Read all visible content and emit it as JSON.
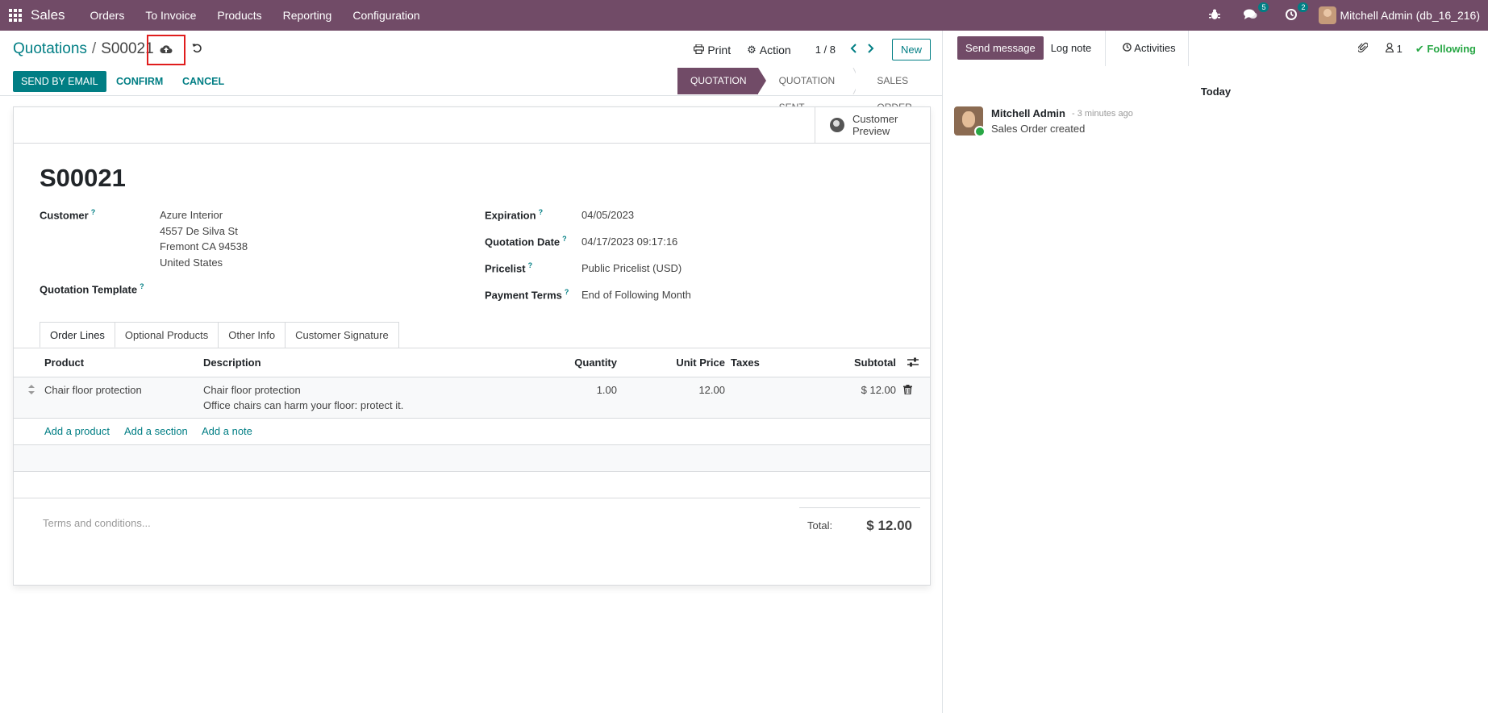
{
  "navbar": {
    "brand": "Sales",
    "menu": [
      "Orders",
      "To Invoice",
      "Products",
      "Reporting",
      "Configuration"
    ],
    "messages_badge": "5",
    "activities_badge": "2",
    "user_name": "Mitchell Admin (db_16_216)",
    "background_color": "#714b67"
  },
  "control_panel": {
    "breadcrumb_parent": "Quotations",
    "breadcrumb_sep": "/",
    "breadcrumb_current": "S00021",
    "print_label": "Print",
    "action_label": "Action",
    "pager": "1 / 8",
    "new_label": "New"
  },
  "actions": {
    "send_by_email": "SEND BY EMAIL",
    "confirm": "CONFIRM",
    "cancel": "CANCEL"
  },
  "stages": [
    "QUOTATION",
    "QUOTATION SENT",
    "SALES ORDER"
  ],
  "active_stage": "QUOTATION",
  "form": {
    "customer_preview": "Customer Preview",
    "title": "S00021",
    "customer_label": "Customer",
    "customer_lines": [
      "Azure Interior",
      "4557 De Silva St",
      "Fremont CA 94538",
      "United States"
    ],
    "quotation_template_label": "Quotation Template",
    "expiration_label": "Expiration",
    "expiration_value": "04/05/2023",
    "quotation_date_label": "Quotation Date",
    "quotation_date_value": "04/17/2023 09:17:16",
    "pricelist_label": "Pricelist",
    "pricelist_value": "Public Pricelist (USD)",
    "payment_terms_label": "Payment Terms",
    "payment_terms_value": "End of Following Month",
    "help_mark": "?"
  },
  "tabs": [
    "Order Lines",
    "Optional Products",
    "Other Info",
    "Customer Signature"
  ],
  "order_lines": {
    "headers": {
      "product": "Product",
      "description": "Description",
      "quantity": "Quantity",
      "unit_price": "Unit Price",
      "taxes": "Taxes",
      "subtotal": "Subtotal"
    },
    "rows": [
      {
        "product": "Chair floor protection",
        "description_1": "Chair floor protection",
        "description_2": "Office chairs can harm your floor: protect it.",
        "quantity": "1.00",
        "unit_price": "12.00",
        "taxes": "",
        "subtotal": "$ 12.00"
      }
    ],
    "add_product": "Add a product",
    "add_section": "Add a section",
    "add_note": "Add a note"
  },
  "footer": {
    "terms_placeholder": "Terms and conditions...",
    "total_label": "Total:",
    "total_value": "$ 12.00"
  },
  "chatter": {
    "send_message": "Send message",
    "log_note": "Log note",
    "activities": "Activities",
    "followers_count": "1",
    "following": "Following",
    "today": "Today",
    "messages": [
      {
        "author": "Mitchell Admin",
        "time": "- 3 minutes ago",
        "body": "Sales Order created"
      }
    ]
  },
  "colors": {
    "brand": "#714b67",
    "accent": "#017e84",
    "highlight_border": "#e01d1d",
    "following": "#28a745"
  }
}
